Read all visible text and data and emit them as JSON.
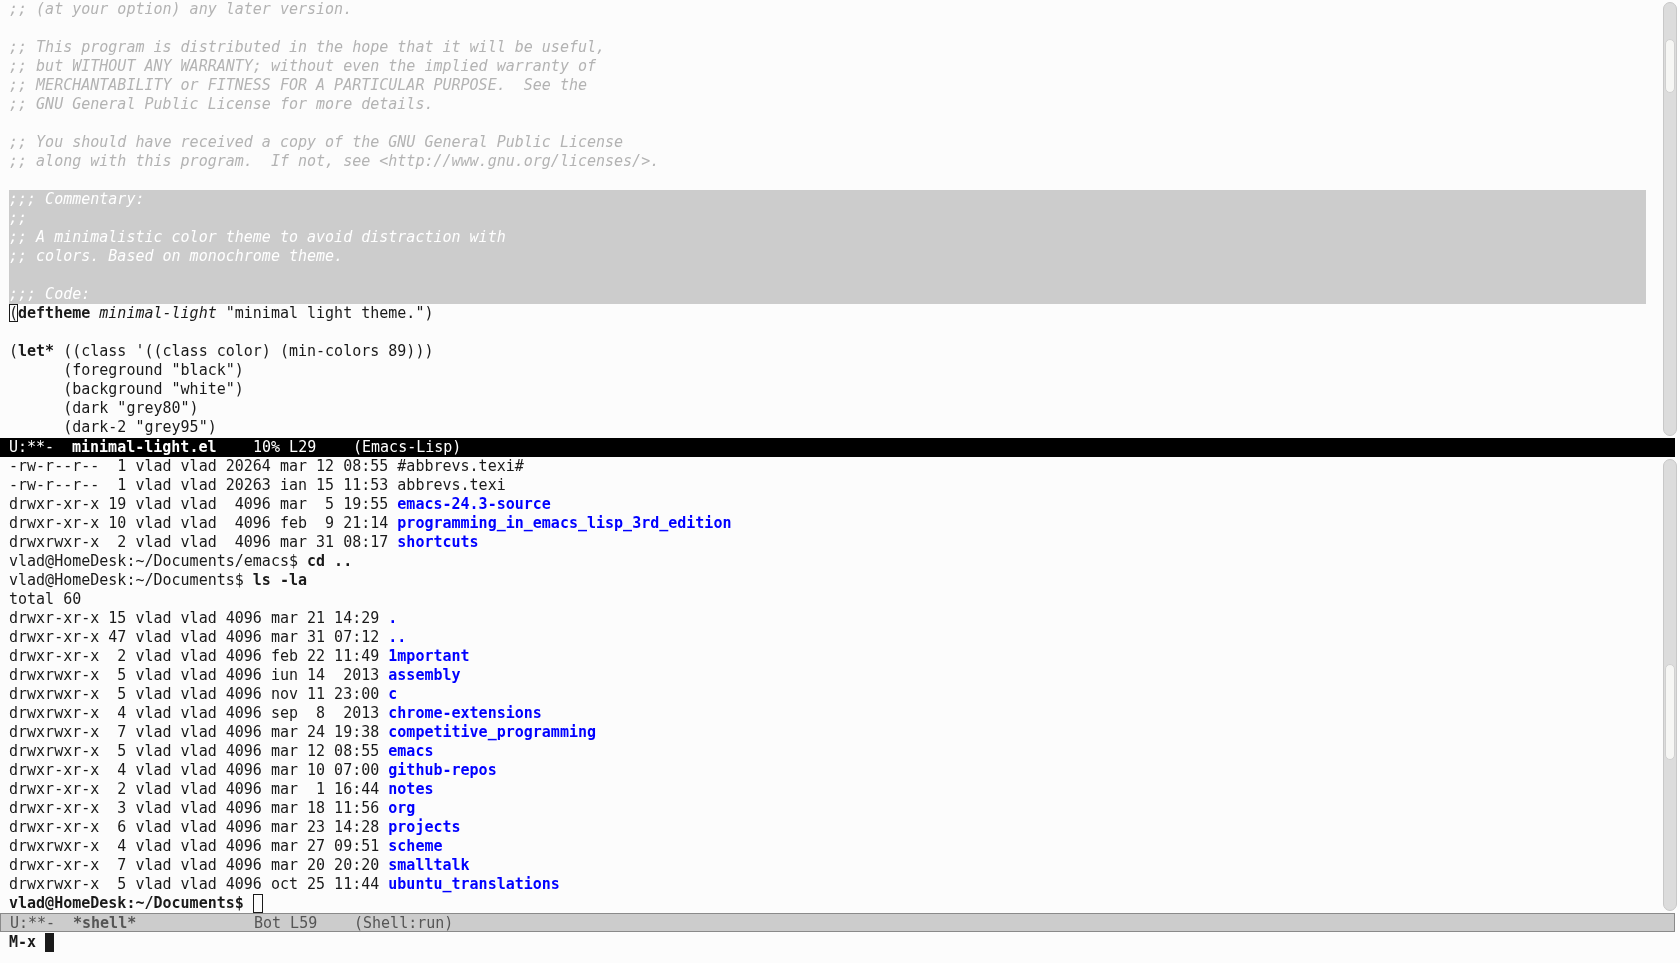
{
  "editor": {
    "lines": [
      {
        "highlighted": false,
        "segments": [
          {
            "kind": "comment",
            "text": ";; (at your option) any later version."
          }
        ]
      },
      {
        "highlighted": false
      },
      {
        "highlighted": false,
        "segments": [
          {
            "kind": "comment",
            "text": ";; This program is distributed in the hope that it will be useful,"
          }
        ]
      },
      {
        "highlighted": false,
        "segments": [
          {
            "kind": "comment",
            "text": ";; but WITHOUT ANY WARRANTY; without even the implied warranty of"
          }
        ]
      },
      {
        "highlighted": false,
        "segments": [
          {
            "kind": "comment",
            "text": ";; MERCHANTABILITY or FITNESS FOR A PARTICULAR PURPOSE.  See the"
          }
        ]
      },
      {
        "highlighted": false,
        "segments": [
          {
            "kind": "comment",
            "text": ";; GNU General Public License for more details."
          }
        ]
      },
      {
        "highlighted": false
      },
      {
        "highlighted": false,
        "segments": [
          {
            "kind": "comment",
            "text": ";; You should have received a copy of the GNU General Public License"
          }
        ]
      },
      {
        "highlighted": false,
        "segments": [
          {
            "kind": "comment",
            "text": ";; along with this program.  If not, see <http://www.gnu.org/licenses/>."
          }
        ]
      },
      {
        "highlighted": false
      },
      {
        "highlighted": true,
        "segments": [
          {
            "kind": "comment",
            "text": ";;; Commentary:"
          }
        ]
      },
      {
        "highlighted": true,
        "segments": [
          {
            "kind": "comment",
            "text": ";;"
          }
        ]
      },
      {
        "highlighted": true,
        "segments": [
          {
            "kind": "comment",
            "text": ";; A minimalistic color theme to avoid distraction with"
          }
        ]
      },
      {
        "highlighted": true,
        "segments": [
          {
            "kind": "comment",
            "text": ";; colors. Based on monochrome theme."
          }
        ]
      },
      {
        "highlighted": true
      },
      {
        "highlighted": true,
        "segments": [
          {
            "kind": "comment",
            "text": ";;; Code:"
          }
        ]
      },
      {
        "highlighted": false,
        "segments": [
          {
            "kind": "cursor",
            "text": "("
          },
          {
            "kind": "keyword",
            "text": "deftheme "
          },
          {
            "kind": "name",
            "text": "minimal-light"
          },
          {
            "kind": "text",
            "text": " \"minimal light theme.\")"
          }
        ]
      },
      {
        "highlighted": false
      },
      {
        "highlighted": false,
        "segments": [
          {
            "kind": "text",
            "text": "("
          },
          {
            "kind": "keyword",
            "text": "let*"
          },
          {
            "kind": "text",
            "text": " ((class '((class color) (min-colors 89)))"
          }
        ]
      },
      {
        "highlighted": false,
        "segments": [
          {
            "kind": "text",
            "text": "      (foreground \"black\")"
          }
        ]
      },
      {
        "highlighted": false,
        "segments": [
          {
            "kind": "text",
            "text": "      (background \"white\")"
          }
        ]
      },
      {
        "highlighted": false,
        "segments": [
          {
            "kind": "text",
            "text": "      (dark \"grey80\")"
          }
        ]
      },
      {
        "highlighted": false,
        "segments": [
          {
            "kind": "text",
            "text": "      (dark-2 \"grey95\")"
          }
        ]
      }
    ],
    "mode_line": {
      "active": true,
      "status": "U:**-",
      "buffer": "minimal-light.el",
      "position": "10% L29",
      "mode": "(Emacs-Lisp)"
    }
  },
  "shell": {
    "lines": [
      {
        "segments": [
          {
            "kind": "text",
            "text": "-rw-r--r--  1 vlad vlad 20264 mar 12 08:55 #abbrevs.texi#"
          }
        ]
      },
      {
        "segments": [
          {
            "kind": "text",
            "text": "-rw-r--r--  1 vlad vlad 20263 ian 15 11:53 abbrevs.texi"
          }
        ]
      },
      {
        "segments": [
          {
            "kind": "text",
            "text": "drwxr-xr-x 19 vlad vlad  4096 mar  5 19:55 "
          },
          {
            "kind": "dir",
            "text": "emacs-24.3-source"
          }
        ]
      },
      {
        "segments": [
          {
            "kind": "text",
            "text": "drwxr-xr-x 10 vlad vlad  4096 feb  9 21:14 "
          },
          {
            "kind": "dir",
            "text": "programming_in_emacs_lisp_3rd_edition"
          }
        ]
      },
      {
        "segments": [
          {
            "kind": "text",
            "text": "drwxrwxr-x  2 vlad vlad  4096 mar 31 08:17 "
          },
          {
            "kind": "dir",
            "text": "shortcuts"
          }
        ]
      },
      {
        "segments": [
          {
            "kind": "text",
            "text": "vlad@HomeDesk:~/Documents/emacs$ "
          },
          {
            "kind": "command",
            "text": "cd .."
          }
        ]
      },
      {
        "segments": [
          {
            "kind": "text",
            "text": "vlad@HomeDesk:~/Documents$ "
          },
          {
            "kind": "command",
            "text": "ls -la"
          }
        ]
      },
      {
        "segments": [
          {
            "kind": "text",
            "text": "total 60"
          }
        ]
      },
      {
        "segments": [
          {
            "kind": "text",
            "text": "drwxr-xr-x 15 vlad vlad 4096 mar 21 14:29 "
          },
          {
            "kind": "dir",
            "text": "."
          }
        ]
      },
      {
        "segments": [
          {
            "kind": "text",
            "text": "drwxr-xr-x 47 vlad vlad 4096 mar 31 07:12 "
          },
          {
            "kind": "dir",
            "text": ".."
          }
        ]
      },
      {
        "segments": [
          {
            "kind": "text",
            "text": "drwxr-xr-x  2 vlad vlad 4096 feb 22 11:49 "
          },
          {
            "kind": "dir",
            "text": "1mportant"
          }
        ]
      },
      {
        "segments": [
          {
            "kind": "text",
            "text": "drwxrwxr-x  5 vlad vlad 4096 iun 14  2013 "
          },
          {
            "kind": "dir",
            "text": "assembly"
          }
        ]
      },
      {
        "segments": [
          {
            "kind": "text",
            "text": "drwxrwxr-x  5 vlad vlad 4096 nov 11 23:00 "
          },
          {
            "kind": "dir",
            "text": "c"
          }
        ]
      },
      {
        "segments": [
          {
            "kind": "text",
            "text": "drwxrwxr-x  4 vlad vlad 4096 sep  8  2013 "
          },
          {
            "kind": "dir",
            "text": "chrome-extensions"
          }
        ]
      },
      {
        "segments": [
          {
            "kind": "text",
            "text": "drwxrwxr-x  7 vlad vlad 4096 mar 24 19:38 "
          },
          {
            "kind": "dir",
            "text": "competitive_programming"
          }
        ]
      },
      {
        "segments": [
          {
            "kind": "text",
            "text": "drwxrwxr-x  5 vlad vlad 4096 mar 12 08:55 "
          },
          {
            "kind": "dir",
            "text": "emacs"
          }
        ]
      },
      {
        "segments": [
          {
            "kind": "text",
            "text": "drwxr-xr-x  4 vlad vlad 4096 mar 10 07:00 "
          },
          {
            "kind": "dir",
            "text": "github-repos"
          }
        ]
      },
      {
        "segments": [
          {
            "kind": "text",
            "text": "drwxr-xr-x  2 vlad vlad 4096 mar  1 16:44 "
          },
          {
            "kind": "dir",
            "text": "notes"
          }
        ]
      },
      {
        "segments": [
          {
            "kind": "text",
            "text": "drwxr-xr-x  3 vlad vlad 4096 mar 18 11:56 "
          },
          {
            "kind": "dir",
            "text": "org"
          }
        ]
      },
      {
        "segments": [
          {
            "kind": "text",
            "text": "drwxr-xr-x  6 vlad vlad 4096 mar 23 14:28 "
          },
          {
            "kind": "dir",
            "text": "projects"
          }
        ]
      },
      {
        "segments": [
          {
            "kind": "text",
            "text": "drwxrwxr-x  4 vlad vlad 4096 mar 27 09:51 "
          },
          {
            "kind": "dir",
            "text": "scheme"
          }
        ]
      },
      {
        "segments": [
          {
            "kind": "text",
            "text": "drwxr-xr-x  7 vlad vlad 4096 mar 20 20:20 "
          },
          {
            "kind": "dir",
            "text": "smalltalk"
          }
        ]
      },
      {
        "segments": [
          {
            "kind": "text",
            "text": "drwxrwxr-x  5 vlad vlad 4096 oct 25 11:44 "
          },
          {
            "kind": "dir",
            "text": "ubuntu_translations"
          }
        ]
      }
    ],
    "prompt": "vlad@HomeDesk:~/Documents$",
    "mode_line": {
      "active": false,
      "status": "U:**-",
      "buffer": "*shell*",
      "position": "Bot L59",
      "mode": "(Shell:run)"
    }
  },
  "minibuffer": {
    "prompt": "M-x"
  }
}
